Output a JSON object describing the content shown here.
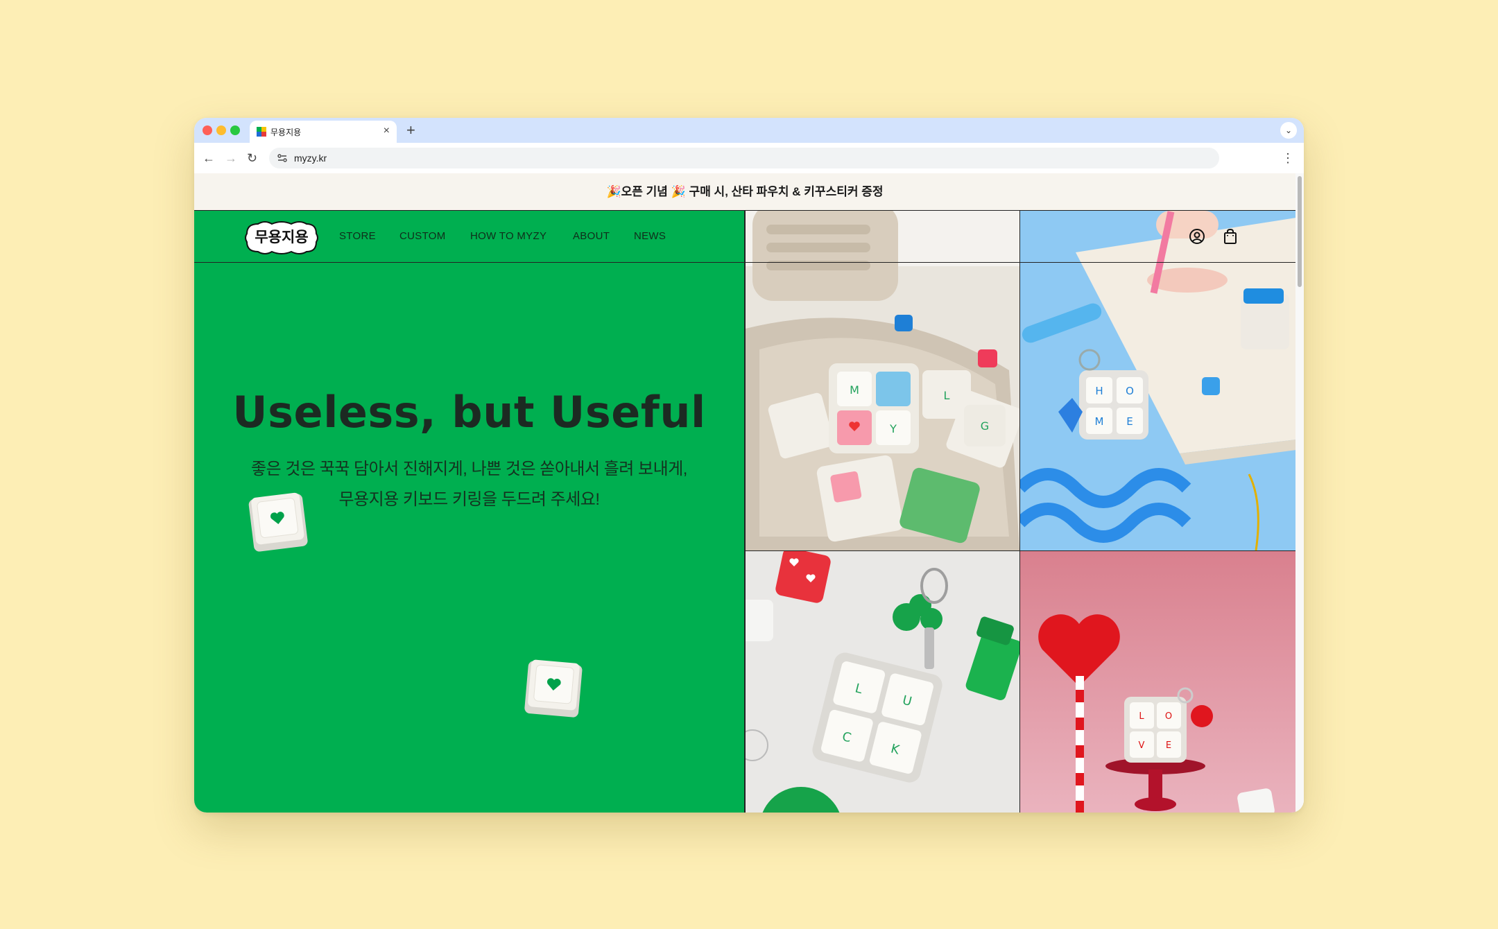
{
  "browser": {
    "tab_title": "무용지용",
    "url": "myzy.kr",
    "new_tab_symbol": "+",
    "close_symbol": "×"
  },
  "announcement": "🎉오픈 기념 🎉 구매 시, 산타 파우치 & 키꾸스티커 증정",
  "header": {
    "logo": "무용지용",
    "nav": [
      "STORE",
      "CUSTOM",
      "HOW TO MYZY",
      "ABOUT",
      "NEWS"
    ],
    "icons": [
      "user-account-icon",
      "shopping-bag-icon"
    ]
  },
  "hero": {
    "headline": "Useless, but Useful",
    "subtitle_line1": "좋은 것은 꾹꾹 담아서 진해지게, 나쁜 것은 쏟아내서 흘려 보내게,",
    "subtitle_line2": "무용지용 키보드 키링을 두드려 주세요!"
  },
  "gallery": {
    "tile1_keys": [
      "M",
      "Y",
      "L",
      "G"
    ],
    "tile2_keys": [
      "H",
      "O",
      "M",
      "E"
    ],
    "tile3_keys": [
      "L",
      "U",
      "C",
      "K"
    ],
    "tile4_keys": [
      "L",
      "O",
      "V",
      "E"
    ]
  },
  "colors": {
    "page_background": "#fdeeb5",
    "brand_green": "#00af50",
    "announcement_bg": "#f7f4ee",
    "text_dark": "#1c2a22"
  }
}
